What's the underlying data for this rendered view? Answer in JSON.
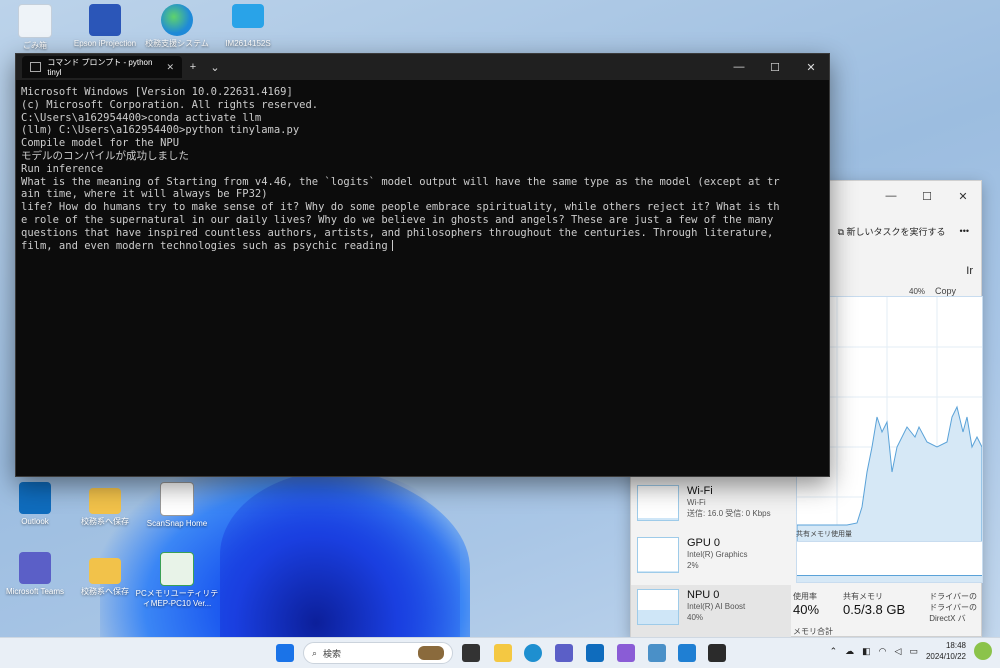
{
  "desktop": {
    "icons": [
      {
        "label": "ごみ箱",
        "color": "#e8eef5"
      },
      {
        "label": "Epson iProjection",
        "color": "#2b56b8"
      },
      {
        "label": "校務支援システム",
        "color": "#1f8ad8"
      },
      {
        "label": "IM2614152S",
        "color": "#29a3e8"
      },
      {
        "label": "Outlook",
        "color": "#0f6cbd"
      },
      {
        "label": "校務系へ保存",
        "color": "#f2c24a"
      },
      {
        "label": "ScanSnap Home",
        "color": "#1c1c1c"
      },
      {
        "label": "Microsoft Teams",
        "color": "#5b5fc7"
      },
      {
        "label": "校務系へ保存",
        "color": "#f2c24a"
      },
      {
        "label": "PCメモリユーティリティMEP-PC10 Ver...",
        "color": "#3aa055"
      }
    ]
  },
  "terminal": {
    "tab_title": "コマンド プロンプト - python  tinyl",
    "new_tab": "+",
    "dropdown": "⌄",
    "minimize": "—",
    "maximize": "☐",
    "close": "✕",
    "lines": [
      "Microsoft Windows [Version 10.0.22631.4169]",
      "(c) Microsoft Corporation. All rights reserved.",
      "",
      "C:\\Users\\a162954400>conda activate llm",
      "",
      "(llm) C:\\Users\\a162954400>python tinylama.py",
      "Compile model for the NPU",
      "モデルのコンパイルが成功しました",
      "Run inference",
      "What is the meaning of Starting from v4.46, the `logits` model output will have the same type as the model (except at tr",
      "ain time, where it will always be FP32)",
      "life? How do humans try to make sense of it? Why do some people embrace spirituality, while others reject it? What is th",
      "e role of the supernatural in our daily lives? Why do we believe in ghosts and angels? These are just a few of the many",
      "questions that have inspired countless authors, artists, and philosophers throughout the centuries. Through literature,",
      "film, and even modern technologies such as psychic reading"
    ]
  },
  "task_manager": {
    "run_task": "新しいタスクを実行する",
    "more": "•••",
    "graph_label_pct": "40%",
    "graph_copy": "Copy",
    "edge_char": "Ir",
    "shared_memory": "共有メモリ使用量",
    "side": [
      {
        "name": "Wi-Fi",
        "sub1": "Wi-Fi",
        "sub2": "送信: 16.0  受信: 0 Kbps",
        "fill": 0.05
      },
      {
        "name": "GPU 0",
        "sub1": "Intel(R) Graphics",
        "sub2": "2%",
        "fill": 0.02
      },
      {
        "name": "NPU 0",
        "sub1": "Intel(R) AI Boost",
        "sub2": "40%",
        "fill": 0.4
      }
    ],
    "stats": {
      "util_label": "使用率",
      "util_value": "40%",
      "shared_label": "共有メモリ",
      "shared_value": "0.5/3.8 GB",
      "driver1": "ドライバーの",
      "driver2": "ドライバーの",
      "directx": "DirectX バ",
      "mem_label": "メモリ合計"
    }
  },
  "taskbar": {
    "search_placeholder": "検索",
    "time": "18:48",
    "date": "2024/10/22",
    "apps": [
      {
        "name": "start",
        "color": "#1a73e8"
      },
      {
        "name": "task-view",
        "color": "#333333"
      },
      {
        "name": "file-explorer",
        "color": "#f4c842"
      },
      {
        "name": "edge",
        "color": "#1e8fd0"
      },
      {
        "name": "teams",
        "color": "#5b5fc7"
      },
      {
        "name": "outlook",
        "color": "#0f6cbd"
      },
      {
        "name": "copilot",
        "color": "#8a5cd6"
      },
      {
        "name": "task-manager",
        "color": "#4a90c8"
      },
      {
        "name": "vscode",
        "color": "#1f7fd3"
      },
      {
        "name": "terminal",
        "color": "#2b2b2b"
      }
    ]
  }
}
